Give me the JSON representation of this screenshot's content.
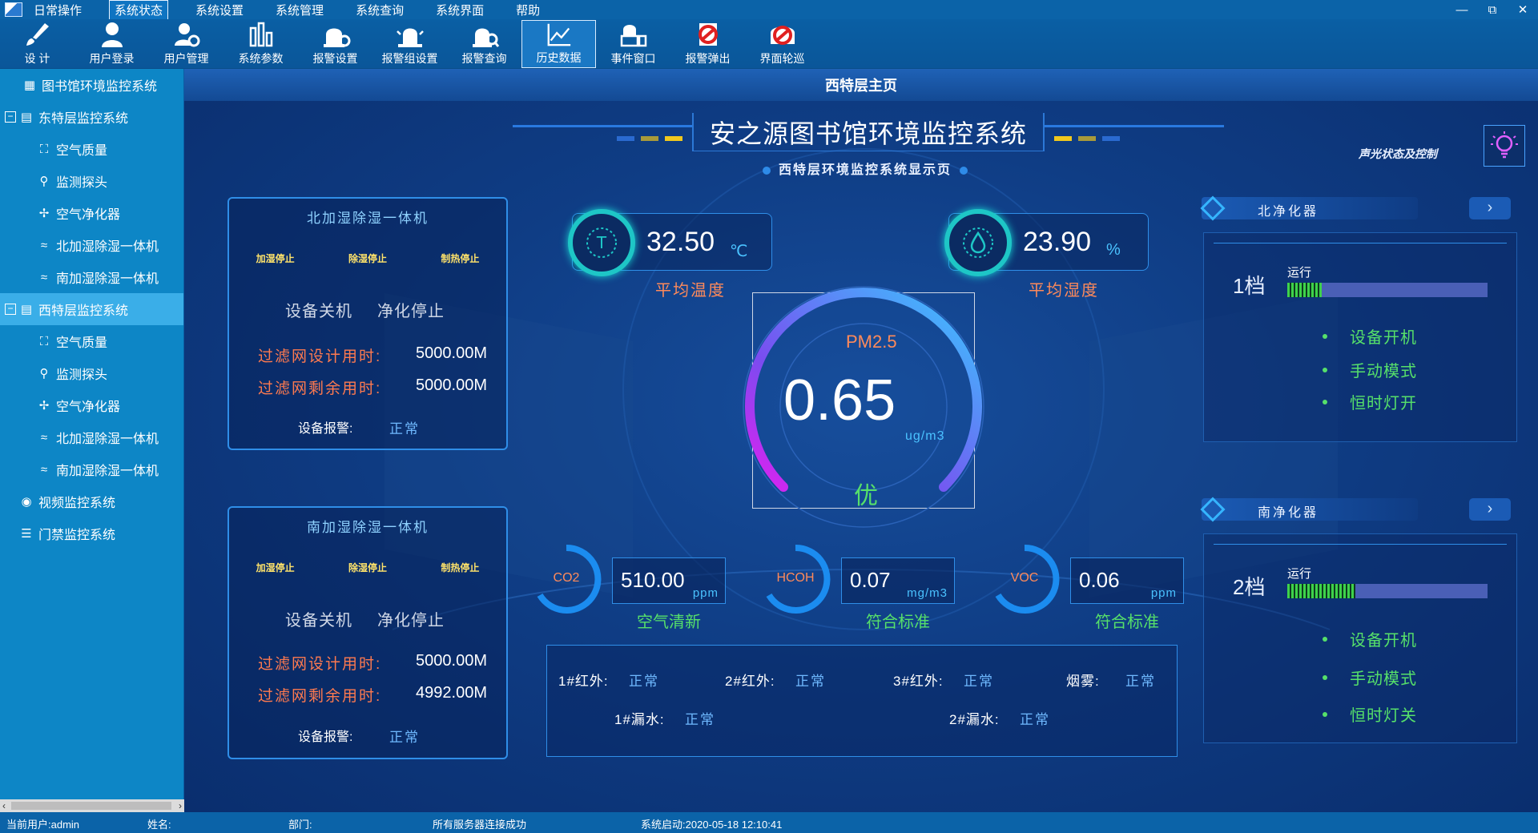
{
  "menubar": {
    "items": [
      "日常操作",
      "系统状态",
      "系统设置",
      "系统管理",
      "系统查询",
      "系统界面",
      "帮助"
    ],
    "active_index": 1,
    "window_controls": [
      "—",
      "⧉",
      "✕"
    ]
  },
  "toolbar": {
    "items": [
      {
        "label": "设  计",
        "icon": "brush-icon"
      },
      {
        "label": "用户登录",
        "icon": "user-login-icon"
      },
      {
        "label": "用户管理",
        "icon": "user-manage-icon"
      },
      {
        "label": "系统参数",
        "icon": "system-params-icon"
      },
      {
        "label": "报警设置",
        "icon": "alarm-settings-icon"
      },
      {
        "label": "报警组设置",
        "icon": "alarm-group-icon"
      },
      {
        "label": "报警查询",
        "icon": "alarm-query-icon"
      },
      {
        "label": "历史数据",
        "icon": "history-chart-icon"
      },
      {
        "label": "事件窗口",
        "icon": "event-window-icon"
      },
      {
        "label": "报警弹出",
        "icon": "alarm-popup-icon"
      },
      {
        "label": "界面轮巡",
        "icon": "screen-patrol-icon"
      }
    ],
    "active_index": 7
  },
  "sidebar": {
    "items": [
      {
        "label": "图书馆环境监控系统",
        "icon": "grid-icon"
      },
      {
        "label": "东特层监控系统",
        "icon": "folder-icon",
        "expander": "⊟"
      },
      {
        "label": "空气质量",
        "icon": "air-quality-icon"
      },
      {
        "label": "监测探头",
        "icon": "probe-icon"
      },
      {
        "label": "空气净化器",
        "icon": "fan-icon"
      },
      {
        "label": "北加湿除湿一体机",
        "icon": "wave-icon"
      },
      {
        "label": "南加湿除湿一体机",
        "icon": "wave-icon"
      },
      {
        "label": "西特层监控系统",
        "icon": "folder-icon",
        "expander": "⊟"
      },
      {
        "label": "空气质量",
        "icon": "air-quality-icon"
      },
      {
        "label": "监测探头",
        "icon": "probe-icon"
      },
      {
        "label": "空气净化器",
        "icon": "fan-icon"
      },
      {
        "label": "北加湿除湿一体机",
        "icon": "wave-icon"
      },
      {
        "label": "南加湿除湿一体机",
        "icon": "wave-icon"
      },
      {
        "label": "视频监控系统",
        "icon": "camera-icon"
      },
      {
        "label": "门禁监控系统",
        "icon": "door-list-icon"
      }
    ],
    "selected_index": 7
  },
  "page": {
    "title": "西特层主页",
    "headline": "安之源图书馆环境监控系统",
    "subtitle": "西特层环境监控系统显示页",
    "sound_light_label": "声光状态及控制"
  },
  "north_humidifier": {
    "title": "北加湿除湿一体机",
    "states": [
      "加湿停止",
      "除湿停止",
      "制热停止"
    ],
    "power": "设备关机",
    "purify": "净化停止",
    "filter_design_label": "过滤网设计用时:",
    "filter_design_value": "5000.00M",
    "filter_remain_label": "过滤网剩余用时:",
    "filter_remain_value": "5000.00M",
    "alarm_label": "设备报警:",
    "alarm_value": "正常"
  },
  "south_humidifier": {
    "title": "南加湿除湿一体机",
    "states": [
      "加湿停止",
      "除湿停止",
      "制热停止"
    ],
    "power": "设备关机",
    "purify": "净化停止",
    "filter_design_label": "过滤网设计用时:",
    "filter_design_value": "5000.00M",
    "filter_remain_label": "过滤网剩余用时:",
    "filter_remain_value": "4992.00M",
    "alarm_label": "设备报警:",
    "alarm_value": "正常"
  },
  "temperature": {
    "value": "32.50",
    "unit": "℃",
    "caption": "平均温度"
  },
  "humidity": {
    "value": "23.90",
    "unit": "%",
    "caption": "平均湿度"
  },
  "pm25": {
    "label": "PM2.5",
    "value": "0.65",
    "unit": "ug/m3",
    "grade": "优"
  },
  "co2": {
    "name": "CO2",
    "value": "510.00",
    "unit": "ppm",
    "caption": "空气清新"
  },
  "hcoh": {
    "name": "HCOH",
    "value": "0.07",
    "unit": "mg/m3",
    "caption": "符合标准"
  },
  "voc": {
    "name": "VOC",
    "value": "0.06",
    "unit": "ppm",
    "caption": "符合标准"
  },
  "sensors": {
    "ir1": {
      "label": "1#红外:",
      "value": "正常"
    },
    "ir2": {
      "label": "2#红外:",
      "value": "正常"
    },
    "ir3": {
      "label": "3#红外:",
      "value": "正常"
    },
    "smoke": {
      "label": "烟雾:",
      "value": "正常"
    },
    "leak1": {
      "label": "1#漏水:",
      "value": "正常"
    },
    "leak2": {
      "label": "2#漏水:",
      "value": "正常"
    }
  },
  "north_purifier": {
    "title": "北净化器",
    "gear": "1档",
    "run_label": "运行",
    "run_level": 0.17,
    "items": [
      "设备开机",
      "手动模式",
      "恒时灯开"
    ]
  },
  "south_purifier": {
    "title": "南净化器",
    "gear": "2档",
    "run_label": "运行",
    "run_level": 0.34,
    "items": [
      "设备开机",
      "手动模式",
      "恒时灯关"
    ]
  },
  "statusbar": {
    "user": "当前用户:admin",
    "name": "姓名:",
    "dept": "部门:",
    "server": "所有服务器连接成功",
    "start": "系统启动:2020-05-18 12:10:41"
  },
  "colors": {
    "accent": "#2f8ee8",
    "ok_green": "#56e06a",
    "label_orange": "#ff8a5a",
    "sidebar": "#0d86c6"
  }
}
